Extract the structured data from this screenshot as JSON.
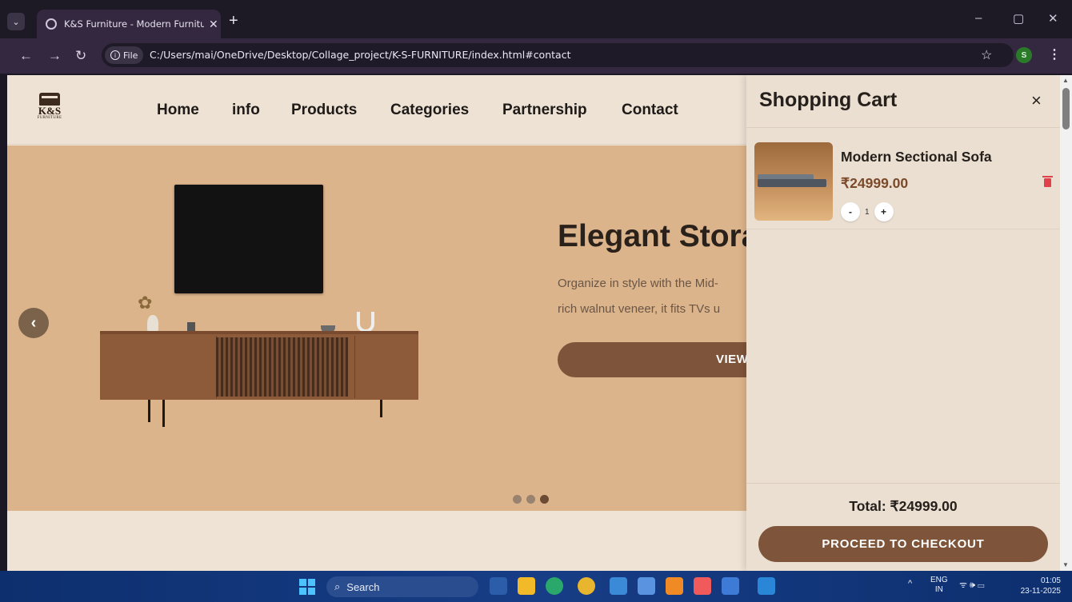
{
  "browser": {
    "tab_title": "K&S Furniture - Modern Furniture",
    "tab_close": "✕",
    "new_tab": "+",
    "file_label": "File",
    "url": "C:/Users/mai/OneDrive/Desktop/Collage_project/K-S-FURNITURE/index.html#contact",
    "profile_initial": "S",
    "window_controls": [
      "–",
      "▢",
      "✕"
    ]
  },
  "site": {
    "logo_brand": "K&S",
    "logo_sub": "FURNITURE",
    "nav": [
      "Home",
      "info",
      "Products",
      "Categories",
      "Partnership",
      "Contact"
    ]
  },
  "hero": {
    "title": "Elegant Stora",
    "desc_line1": "Organize in style with the Mid-",
    "desc_line2": "rich walnut veneer, it fits TVs u",
    "button": "VIEW",
    "prev_arrow": "‹",
    "slide_count": 3,
    "active_slide": 3
  },
  "cart": {
    "title": "Shopping Cart",
    "close": "×",
    "items": [
      {
        "name": "Modern Sectional Sofa",
        "price": "₹24999.00",
        "qty": "1",
        "minus": "-",
        "plus": "+"
      }
    ],
    "total": "Total: ₹24999.00",
    "checkout": "PROCEED TO CHECKOUT"
  },
  "taskbar": {
    "search_label": "Search",
    "tray_up": "^",
    "lang_1": "ENG",
    "lang_2": "IN",
    "time": "01:05",
    "date": "23-11-2025",
    "tray_icons": "ᯤ 🕪 ▭"
  },
  "colors": {
    "accent": "#7e553a",
    "hero_bg": "#dcb48c",
    "page_bg": "#efe3d6",
    "trash": "#e0414a"
  }
}
